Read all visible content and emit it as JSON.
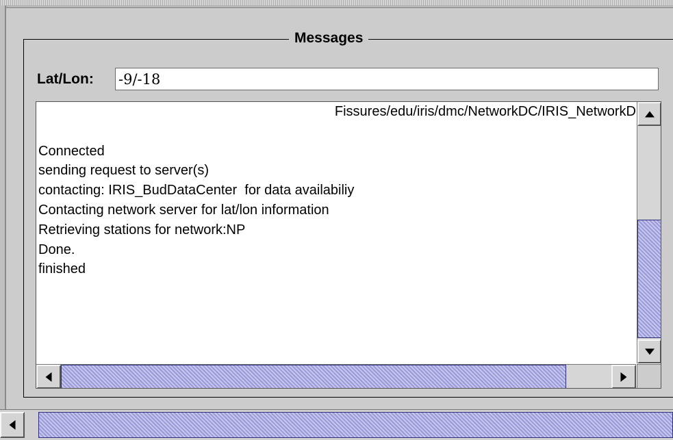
{
  "messages_panel": {
    "title": "Messages",
    "latlon": {
      "label": "Lat/Lon:",
      "value": "-9/-18"
    },
    "log_lines": [
      "Fissures/edu/iris/dmc/NetworkDC/IRIS_NetworkD",
      "",
      "Connected",
      "sending request to server(s)",
      "contacting: IRIS_BudDataCenter  for data availabiliy",
      "Contacting network server for lat/lon information",
      "Retrieving stations for network:NP",
      "Done.",
      "finished"
    ],
    "vertical_scroll_position": 0.75,
    "horizontal_scroll_position": 0.0
  },
  "icons": {
    "scroll_up": "arrow-up-icon",
    "scroll_down": "arrow-down-icon",
    "scroll_left": "arrow-left-icon",
    "scroll_right": "arrow-right-icon"
  },
  "colors": {
    "scroll_thumb": "#9a9ad8",
    "background": "#cccccc"
  }
}
